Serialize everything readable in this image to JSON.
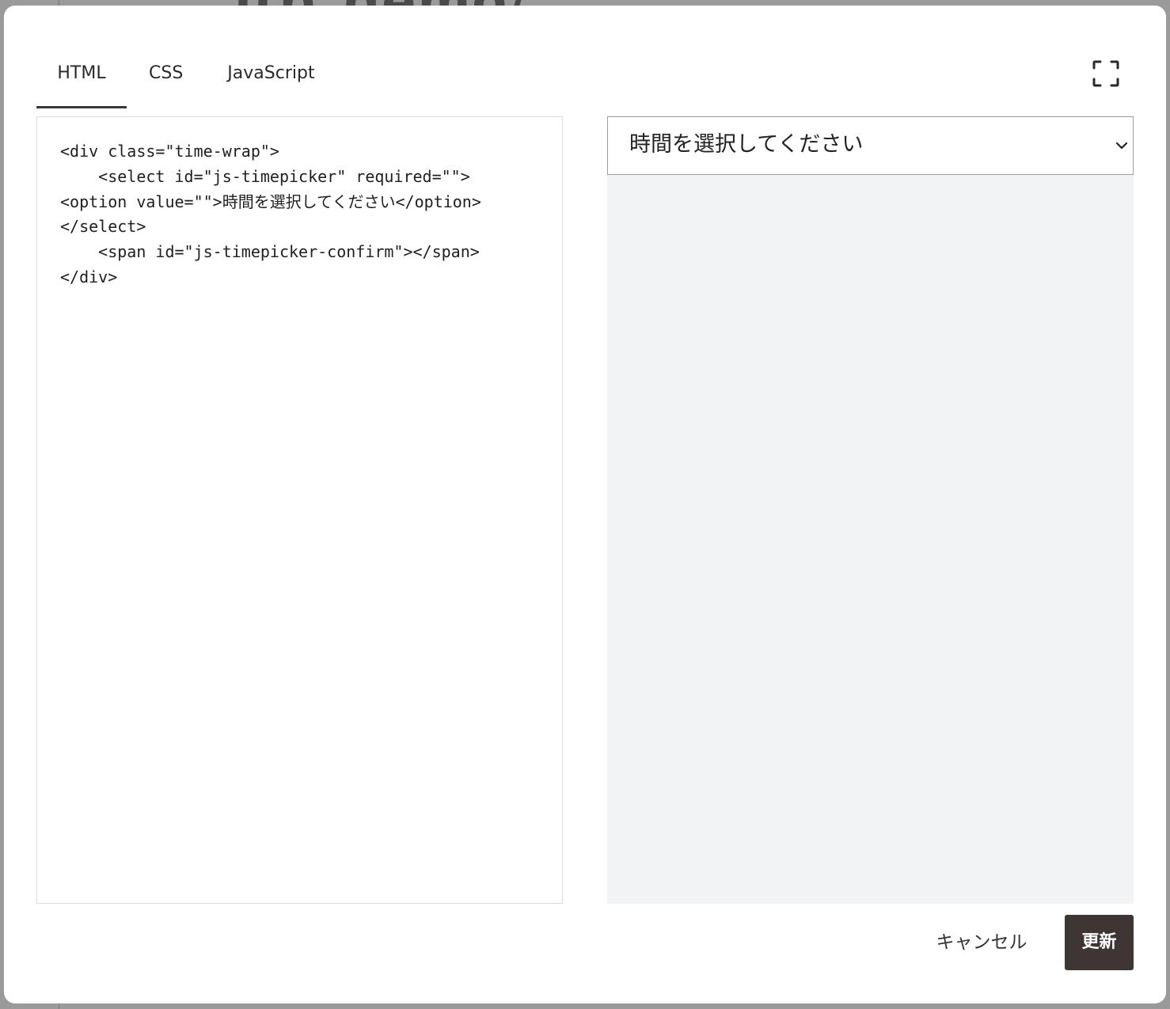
{
  "backdrop": {
    "title_fragment": "itp_demo/"
  },
  "tabs": [
    {
      "label": "HTML",
      "active": true
    },
    {
      "label": "CSS",
      "active": false
    },
    {
      "label": "JavaScript",
      "active": false
    }
  ],
  "toolbar": {
    "fullscreen_icon": "fullscreen-icon"
  },
  "editor": {
    "code": "<div class=\"time-wrap\">\n    <select id=\"js-timepicker\" required=\"\">\n<option value=\"\">時間を選択してください</option>\n</select>\n    <span id=\"js-timepicker-confirm\"></span>\n</div>"
  },
  "preview": {
    "select_value": "時間を選択してください",
    "chevron_icon": "chevron-down-icon"
  },
  "footer": {
    "cancel_label": "キャンセル",
    "update_label": "更新"
  },
  "colors": {
    "accent": "#3d3635",
    "preview_bg": "#f2f3f5",
    "overlay": "#9a9a9a"
  }
}
